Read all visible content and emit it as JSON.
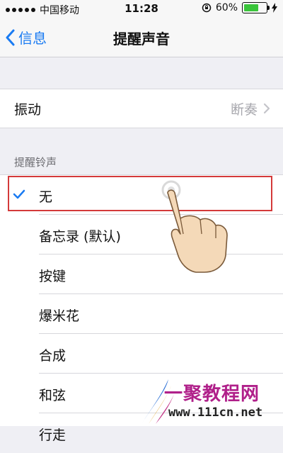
{
  "status": {
    "carrier": "中国移动",
    "time": "11:28",
    "battery_text": "60%",
    "battery_level": 0.6
  },
  "nav": {
    "back_label": "信息",
    "title": "提醒声音"
  },
  "vibration": {
    "label": "振动",
    "value": "断奏"
  },
  "section": {
    "header": "提醒铃声"
  },
  "tones": [
    {
      "label": "无",
      "selected": true
    },
    {
      "label": "备忘录 (默认)",
      "selected": false
    },
    {
      "label": "按键",
      "selected": false
    },
    {
      "label": "爆米花",
      "selected": false
    },
    {
      "label": "合成",
      "selected": false
    },
    {
      "label": "和弦",
      "selected": false
    },
    {
      "label": "行走",
      "selected": false
    }
  ],
  "watermark": {
    "name": "一聚教程网",
    "url": "www.111cn.net"
  },
  "colors": {
    "accent": "#1a7bf2",
    "highlight": "#d43a3a",
    "battery": "#39c43a"
  }
}
